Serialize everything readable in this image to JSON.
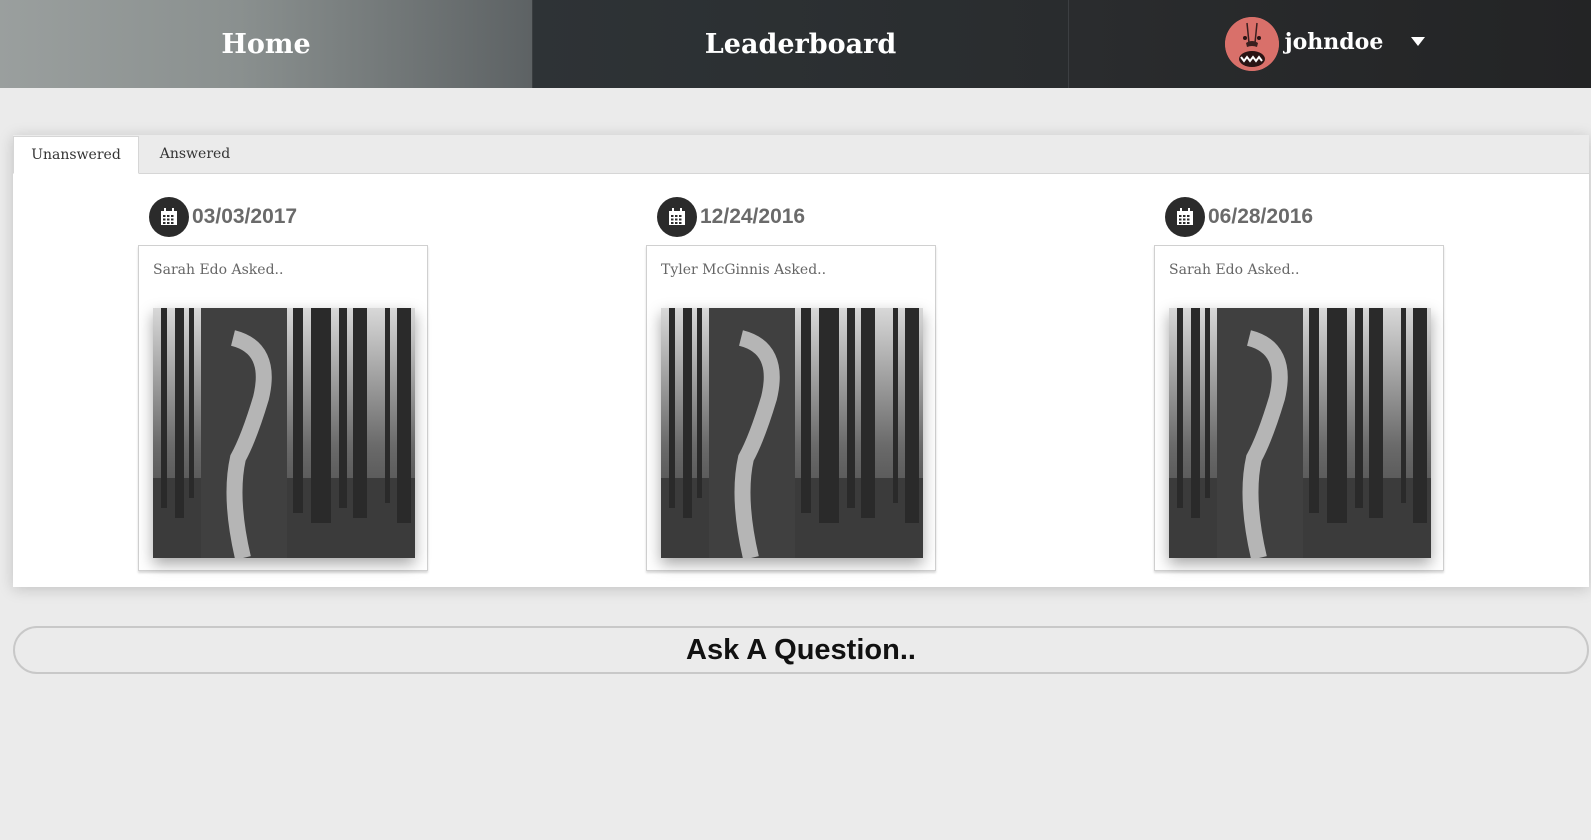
{
  "nav": {
    "home_label": "Home",
    "leaderboard_label": "Leaderboard",
    "username": "johndoe"
  },
  "tabs": [
    {
      "label": "Unanswered",
      "active": true
    },
    {
      "label": "Answered",
      "active": false
    }
  ],
  "questions": [
    {
      "date": "03/03/2017",
      "asker": "Sarah Edo Asked.."
    },
    {
      "date": "12/24/2016",
      "asker": "Tyler McGinnis Asked.."
    },
    {
      "date": "06/28/2016",
      "asker": "Sarah Edo Asked.."
    }
  ],
  "ask_button_label": "Ask A Question..",
  "colors": {
    "background": "#ebebeb",
    "nav_dark": "#292c2e",
    "avatar": "#d9706a",
    "date_icon_bg": "#2b2b2b"
  },
  "icons": {
    "date": "calendar-icon",
    "dropdown": "caret-down-icon"
  }
}
